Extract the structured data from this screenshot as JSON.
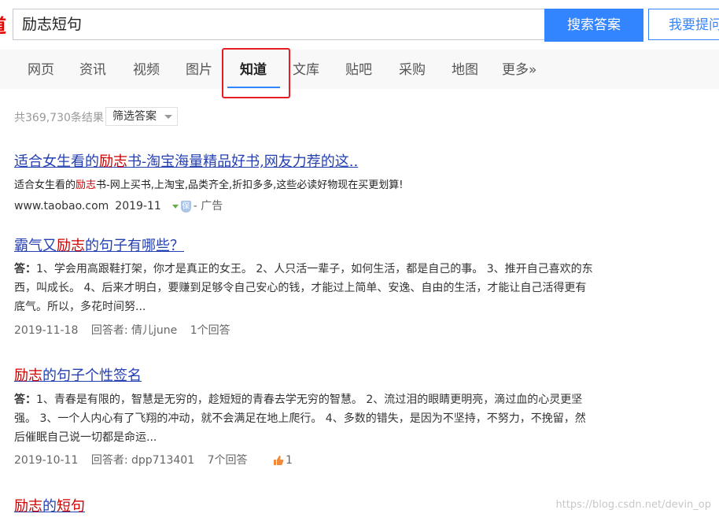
{
  "logo_fragment": "道",
  "search": {
    "value": "励志短句",
    "button_label": "搜索答案",
    "ask_label": "我要提问"
  },
  "tabs": [
    {
      "label": "网页"
    },
    {
      "label": "资讯"
    },
    {
      "label": "视频"
    },
    {
      "label": "图片"
    },
    {
      "label": "知道",
      "active": true
    },
    {
      "label": "文库"
    },
    {
      "label": "贴吧"
    },
    {
      "label": "采购"
    },
    {
      "label": "地图"
    },
    {
      "label": "更多»"
    }
  ],
  "result_count": "共369,730条结果",
  "filter_label": "筛选答案",
  "results": [
    {
      "title_parts": [
        "适合女生看的",
        "励志",
        "书-淘宝海量精品好书,网友力荐的这.."
      ],
      "snippet_parts": [
        "适合女生看的",
        "励志",
        "书-网上买书,上淘宝,品类齐全,折扣多多,这些必读好物现在买更划算!"
      ],
      "url": "www.taobao.com",
      "date": "2019-11",
      "ad_label": "- 广告",
      "shield_glyph": "保"
    },
    {
      "title_parts": [
        "霸气又",
        "励志",
        "的句子有哪些？"
      ],
      "answer_prefix": "答：",
      "snippet": "1、学会用高跟鞋打架，你才是真正的女王。 2、人只活一辈子，如何生活，都是自己的事。 3、推开自己喜欢的东西，叫成长。 4、后来才明白，要赚到足够令自己安心的钱，才能过上简单、安逸、自由的生活，才能让自己活得更有底气。所以，多花时间努...",
      "date": "2019-11-18",
      "answerer": "回答者: 倩儿june",
      "answer_count": "1个回答"
    },
    {
      "title_parts": [
        "",
        "励志",
        "的句子个性签名"
      ],
      "answer_prefix": "答：",
      "snippet": "1、青春是有限的，智慧是无穷的，趁短短的青春去学无穷的智慧。 2、流过泪的眼睛更明亮，滴过血的心灵更坚强。 3、一个人内心有了飞翔的冲动，就不会满足在地上爬行。 4、多数的错失，是因为不坚持，不努力，不挽留，然后催眠自己说一切都是命运...",
      "date": "2019-10-11",
      "answerer": "回答者: dpp713401",
      "answer_count": "7个回答",
      "likes": "1"
    },
    {
      "title_parts": [
        "",
        "励志",
        "的",
        "短句"
      ]
    }
  ],
  "watermark": "https://blog.csdn.net/devin_op",
  "colors": {
    "accent": "#3385ff",
    "highlight": "#c00",
    "link": "#2440b3",
    "annotation_box": "#e51c23"
  }
}
